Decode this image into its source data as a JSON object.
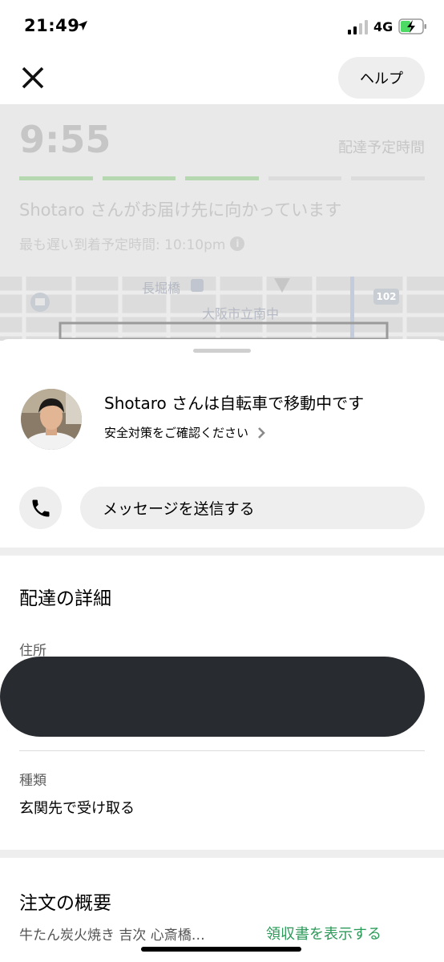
{
  "status_bar": {
    "time": "21:49",
    "network": "4G"
  },
  "header": {
    "help_label": "ヘルプ"
  },
  "tracking": {
    "eta_time": "9:55",
    "eta_label": "配達予定時間",
    "progress_total_steps": 5,
    "progress_completed_steps": 3,
    "status_text": "Shotaro さんがお届け先に向かっています",
    "latest_eta_text": "最も遅い到着予定時間: 10:10pm",
    "info_glyph": "i"
  },
  "map": {
    "labels": [
      "長堀橋",
      "大阪市立南中"
    ],
    "route_number": "102"
  },
  "courier": {
    "title": "Shotaro さんは自転車で移動中です",
    "safety_link": "安全対策をご確認ください",
    "message_button": "メッセージを送信する"
  },
  "delivery_details": {
    "title": "配達の詳細",
    "address_label": "住所",
    "type_label": "種類",
    "type_value": "玄関先で受け取る"
  },
  "order_summary": {
    "title": "注文の概要",
    "store_name": "牛たん炭火焼き 吉次 心斎橋…",
    "receipt_link": "領収書を表示する"
  },
  "colors": {
    "progress_done": "#b6d8b1",
    "link_green": "#2b9a59",
    "redaction": "#282b2f",
    "pill_bg": "#eeeeee"
  },
  "icons": [
    "location-arrow-icon",
    "signal-icon",
    "battery-charging-icon",
    "close-icon",
    "info-icon",
    "chevron-right-icon",
    "phone-icon"
  ]
}
